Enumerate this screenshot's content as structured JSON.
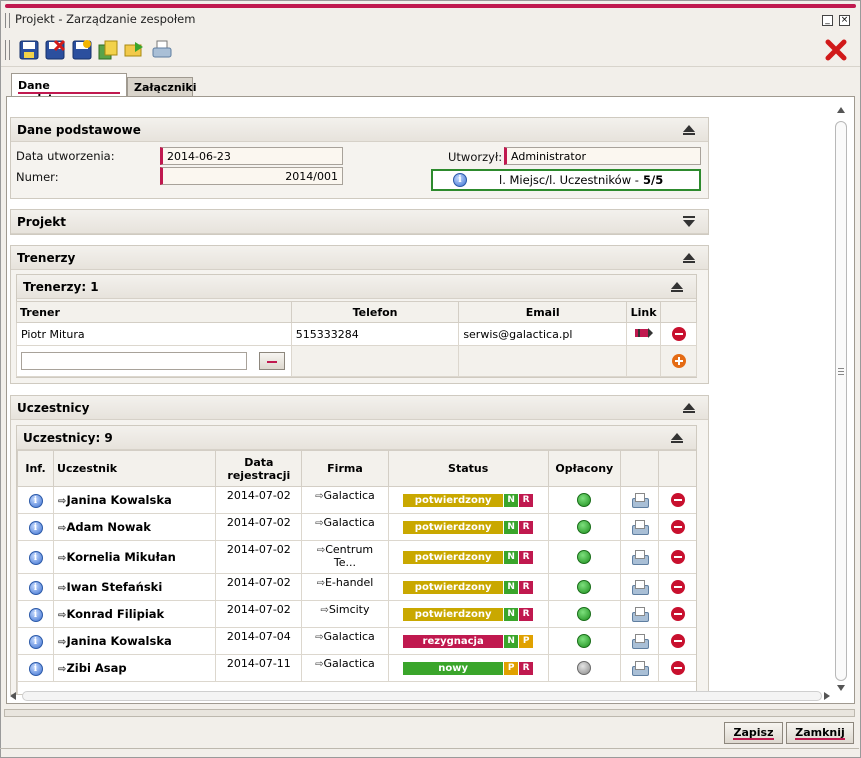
{
  "window": {
    "title": "Projekt - Zarządzanie zespołem",
    "accent": "#c0194f"
  },
  "toolbar": {
    "icons": [
      "save-icon",
      "save-close-icon",
      "save-new-icon",
      "copy-icon",
      "send-icon",
      "print-icon",
      "close-red-icon"
    ]
  },
  "tabs": [
    {
      "label": "Dane podstawowe",
      "active": true
    },
    {
      "label": "Załączniki",
      "active": false
    }
  ],
  "basic": {
    "title": "Dane podstawowe",
    "created_label": "Data utworzenia:",
    "created_value": "2014-06-23",
    "number_label": "Numer:",
    "number_value": "2014/001",
    "author_label": "Utworzył:",
    "author_value": "Administrator",
    "places_label": "l. Miejsc/l. Uczestników -",
    "places_value": "5/5"
  },
  "project": {
    "title": "Projekt"
  },
  "trainers": {
    "title": "Trenerzy",
    "subtitle": "Trenerzy: 1",
    "columns": [
      "Trener",
      "Telefon",
      "Email",
      "Link"
    ],
    "rows": [
      {
        "name": "Piotr Mitura",
        "phone": "515333284",
        "email": "serwis@galactica.pl"
      }
    ]
  },
  "participants": {
    "title": "Uczestnicy",
    "subtitle": "Uczestnicy: 9",
    "columns": [
      "Inf.",
      "Uczestnik",
      "Data rejestracji",
      "Firma",
      "Status",
      "Opłacony"
    ],
    "rows": [
      {
        "name": "Janina Kowalska",
        "date": "2014-07-02",
        "company": "Galactica",
        "status": "potwierdzony",
        "flags": [
          "N",
          "R"
        ],
        "paid": true
      },
      {
        "name": "Adam Nowak",
        "date": "2014-07-02",
        "company": "Galactica",
        "status": "potwierdzony",
        "flags": [
          "N",
          "R"
        ],
        "paid": true
      },
      {
        "name": "Kornelia Mikułan",
        "date": "2014-07-02",
        "company": "Centrum Te...",
        "status": "potwierdzony",
        "flags": [
          "N",
          "R"
        ],
        "paid": true
      },
      {
        "name": "Iwan Stefański",
        "date": "2014-07-02",
        "company": "E-handel",
        "status": "potwierdzony",
        "flags": [
          "N",
          "R"
        ],
        "paid": true
      },
      {
        "name": "Konrad Filipiak",
        "date": "2014-07-02",
        "company": "Simcity",
        "status": "potwierdzony",
        "flags": [
          "N",
          "R"
        ],
        "paid": true
      },
      {
        "name": "Janina Kowalska",
        "date": "2014-07-04",
        "company": "Galactica",
        "status": "rezygnacja",
        "flags": [
          "N",
          "P"
        ],
        "paid": true
      },
      {
        "name": "Zibi Asap",
        "date": "2014-07-11",
        "company": "Galactica",
        "status": "nowy",
        "flags": [
          "P",
          "R"
        ],
        "paid": false
      }
    ]
  },
  "buttons": {
    "save": "Zapisz",
    "close": "Zamknij"
  }
}
